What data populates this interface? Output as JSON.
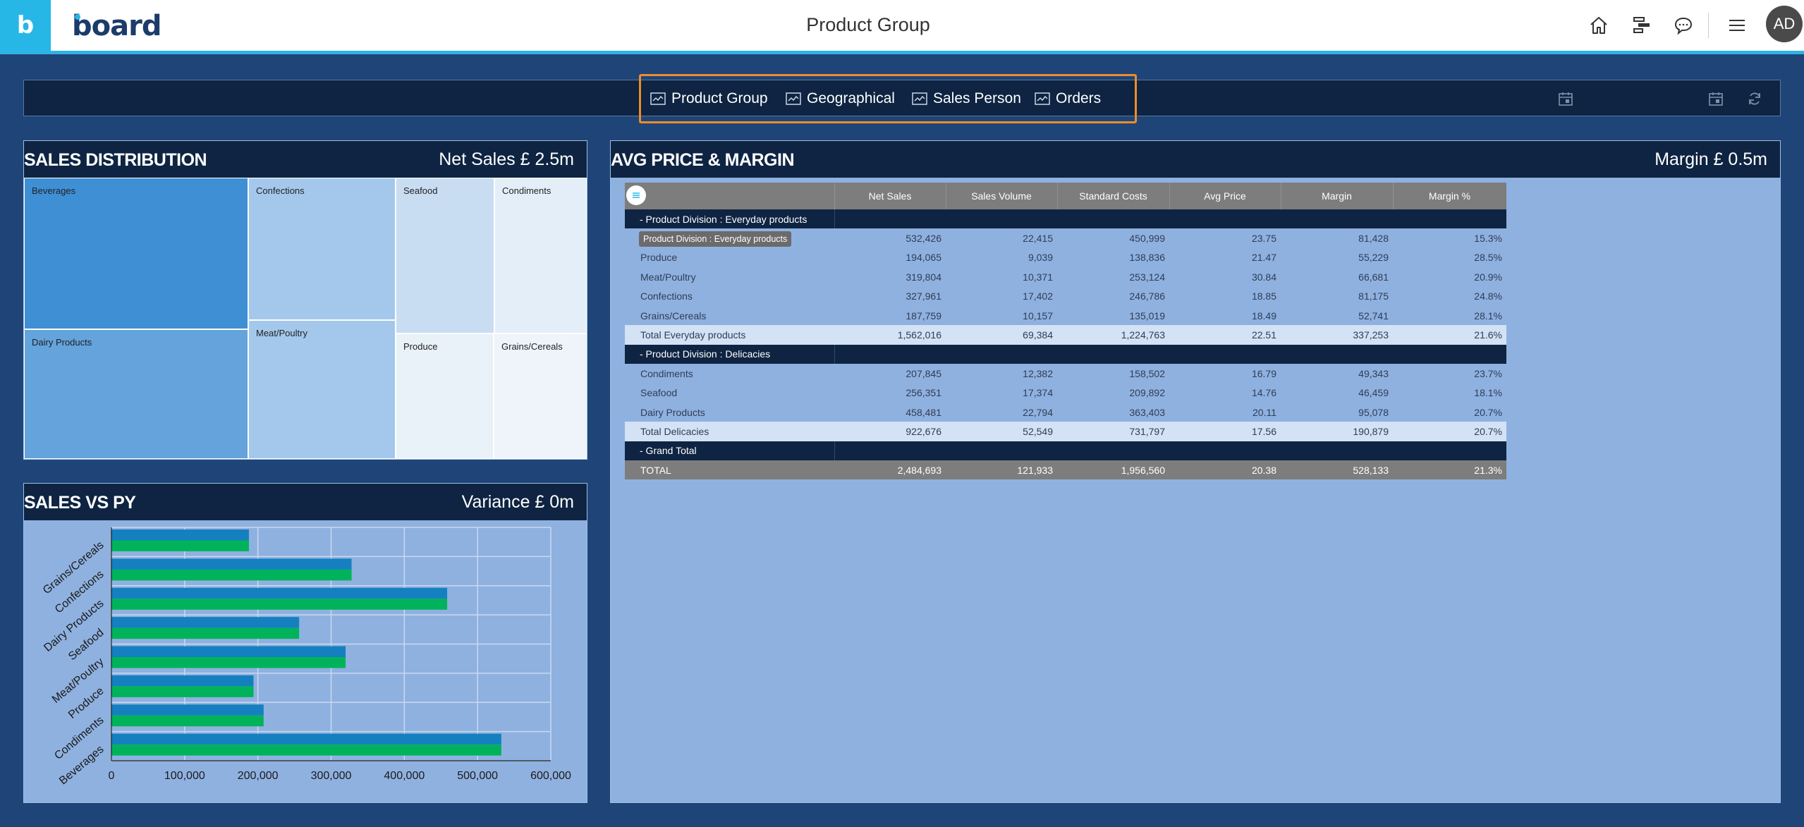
{
  "app": {
    "logo_letter": "b",
    "brand": "board",
    "page_title": "Product Group",
    "user_initials": "AD"
  },
  "menu": {
    "items": [
      {
        "label": "Product Group"
      },
      {
        "label": "Geographical"
      },
      {
        "label": "Sales Person"
      },
      {
        "label": "Orders"
      }
    ]
  },
  "sales_distribution": {
    "title": "SALES DISTRIBUTION",
    "kpi": "Net Sales £ 2.5m",
    "cells": [
      {
        "label": "Beverages"
      },
      {
        "label": "Dairy Products"
      },
      {
        "label": "Confections"
      },
      {
        "label": "Meat/Poultry"
      },
      {
        "label": "Seafood"
      },
      {
        "label": "Condiments"
      },
      {
        "label": "Produce"
      },
      {
        "label": "Grains/Cereals"
      }
    ]
  },
  "sales_vs_py": {
    "title": "SALES VS PY",
    "kpi": "Variance £ 0m"
  },
  "chart_data": {
    "type": "bar",
    "orientation": "horizontal",
    "categories": [
      "Grains/Cereals",
      "Confections",
      "Dairy Products",
      "Seafood",
      "Meat/Poultry",
      "Produce",
      "Condiments",
      "Beverages"
    ],
    "series": [
      {
        "values": [
          187759,
          327961,
          458481,
          256351,
          319804,
          194065,
          207845,
          532426
        ],
        "color": "#1580c0"
      },
      {
        "values": [
          187759,
          327961,
          458481,
          256351,
          319804,
          194065,
          207845,
          532426
        ],
        "color": "#00b35a"
      }
    ],
    "xlim": [
      0,
      600000
    ],
    "xticks": [
      "0",
      "100,000",
      "200,000",
      "300,000",
      "400,000",
      "500,000",
      "600,000"
    ],
    "grid": true
  },
  "avg_price_margin": {
    "title": "AVG PRICE & MARGIN",
    "kpi": "Margin £ 0.5m",
    "tooltip": "Product Division : Everyday products",
    "columns": [
      "Net Sales",
      "Sales Volume",
      "Standard Costs",
      "Avg Price",
      "Margin",
      "Margin %"
    ],
    "rows": [
      {
        "type": "division",
        "label": "-  Product Division : Everyday products"
      },
      {
        "type": "item",
        "label": "",
        "values": [
          "532,426",
          "22,415",
          "450,999",
          "23.75",
          "81,428",
          "15.3%"
        ]
      },
      {
        "type": "item",
        "label": "Produce",
        "values": [
          "194,065",
          "9,039",
          "138,836",
          "21.47",
          "55,229",
          "28.5%"
        ]
      },
      {
        "type": "item",
        "label": "Meat/Poultry",
        "values": [
          "319,804",
          "10,371",
          "253,124",
          "30.84",
          "66,681",
          "20.9%"
        ]
      },
      {
        "type": "item",
        "label": "Confections",
        "values": [
          "327,961",
          "17,402",
          "246,786",
          "18.85",
          "81,175",
          "24.8%"
        ]
      },
      {
        "type": "item",
        "label": "Grains/Cereals",
        "values": [
          "187,759",
          "10,157",
          "135,019",
          "18.49",
          "52,741",
          "28.1%"
        ]
      },
      {
        "type": "total",
        "label": "Total Everyday products",
        "values": [
          "1,562,016",
          "69,384",
          "1,224,763",
          "22.51",
          "337,253",
          "21.6%"
        ]
      },
      {
        "type": "division",
        "label": "-  Product Division : Delicacies"
      },
      {
        "type": "item",
        "label": "Condiments",
        "values": [
          "207,845",
          "12,382",
          "158,502",
          "16.79",
          "49,343",
          "23.7%"
        ]
      },
      {
        "type": "item",
        "label": "Seafood",
        "values": [
          "256,351",
          "17,374",
          "209,892",
          "14.76",
          "46,459",
          "18.1%"
        ]
      },
      {
        "type": "item",
        "label": "Dairy Products",
        "values": [
          "458,481",
          "22,794",
          "363,403",
          "20.11",
          "95,078",
          "20.7%"
        ]
      },
      {
        "type": "total",
        "label": "Total Delicacies",
        "values": [
          "922,676",
          "52,549",
          "731,797",
          "17.56",
          "190,879",
          "20.7%"
        ]
      },
      {
        "type": "division",
        "label": "-  Grand Total"
      },
      {
        "type": "grand",
        "label": "TOTAL",
        "values": [
          "2,484,693",
          "121,933",
          "1,956,560",
          "20.38",
          "528,133",
          "21.3%"
        ]
      }
    ]
  },
  "icons": {
    "home": "home-icon",
    "layout": "layout-icon",
    "chat": "chat-icon",
    "menu": "hamburger-icon",
    "calendar": "calendar-icon",
    "refresh": "refresh-icon"
  },
  "colors": {
    "accent": "#27b7e6",
    "header_bg": "#0e2442",
    "panel_bg": "#8fb1e0",
    "page_bg": "#1f4578",
    "highlight": "#ee8c2b"
  }
}
